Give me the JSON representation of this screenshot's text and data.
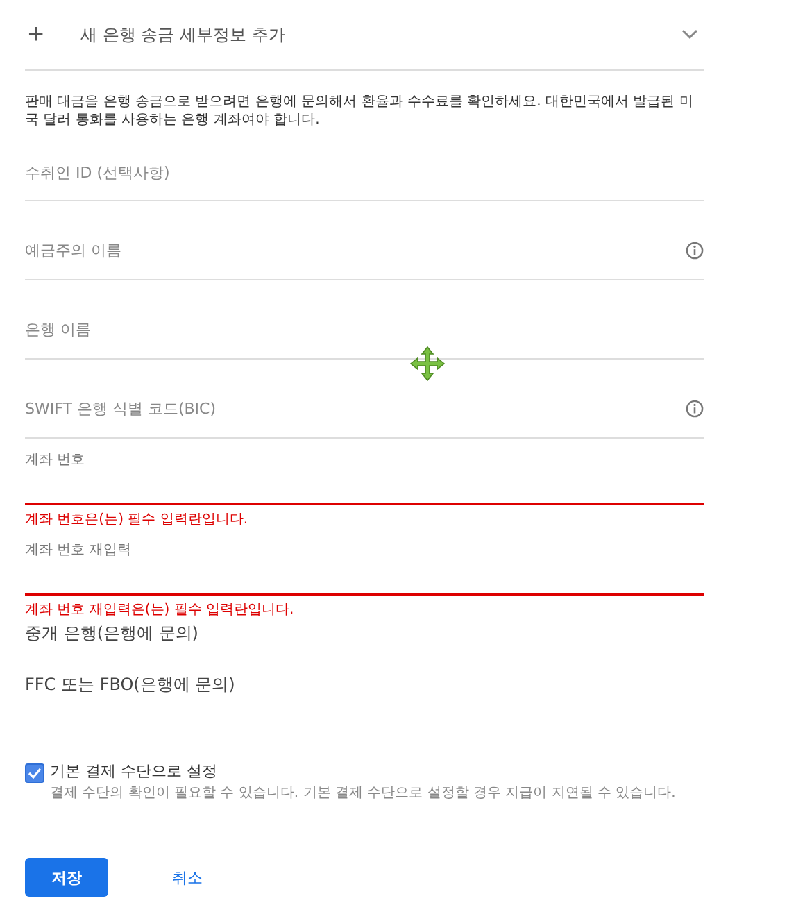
{
  "header": {
    "icon": "+",
    "title": "새 은행 송금 세부정보 추가",
    "expanded": false
  },
  "description": "판매 대금을 은행 송금으로 받으려면 은행에 문의해서 환율과 수수료를 확인하세요. 대한민국에서 발급된 미국 달러 통화를 사용하는 은행 계좌여야 합니다.",
  "fields": [
    {
      "kind": "text",
      "placeholder": "수취인 ID (선택사항)",
      "info": false
    },
    {
      "kind": "text",
      "placeholder": "예금주의 이름",
      "info": true
    },
    {
      "kind": "text",
      "placeholder": "은행 이름",
      "info": false
    },
    {
      "kind": "text",
      "placeholder": "SWIFT 은행 식별 코드(BIC)",
      "info": true
    },
    {
      "kind": "error",
      "label": "계좌 번호",
      "error": "계좌 번호은(는) 필수 입력란입니다."
    },
    {
      "kind": "error",
      "label": "계좌 번호 재입력",
      "error": "계좌 번호 재입력은(는) 필수 입력란입니다."
    }
  ],
  "links": [
    "중개 은행(은행에 문의)",
    "FFC 또는 FBO(은행에 문의)"
  ],
  "default_option": {
    "label": "기본 결제 수단으로 설정",
    "checked": true,
    "note": "결제 수단의 확인이 필요할 수 있습니다. 기본 결제 수단으로 설정할 경우 지급이 지연될 수 있습니다."
  },
  "buttons": [
    {
      "label": "저장",
      "kind": "primary"
    },
    {
      "label": "취소",
      "kind": "text"
    }
  ]
}
